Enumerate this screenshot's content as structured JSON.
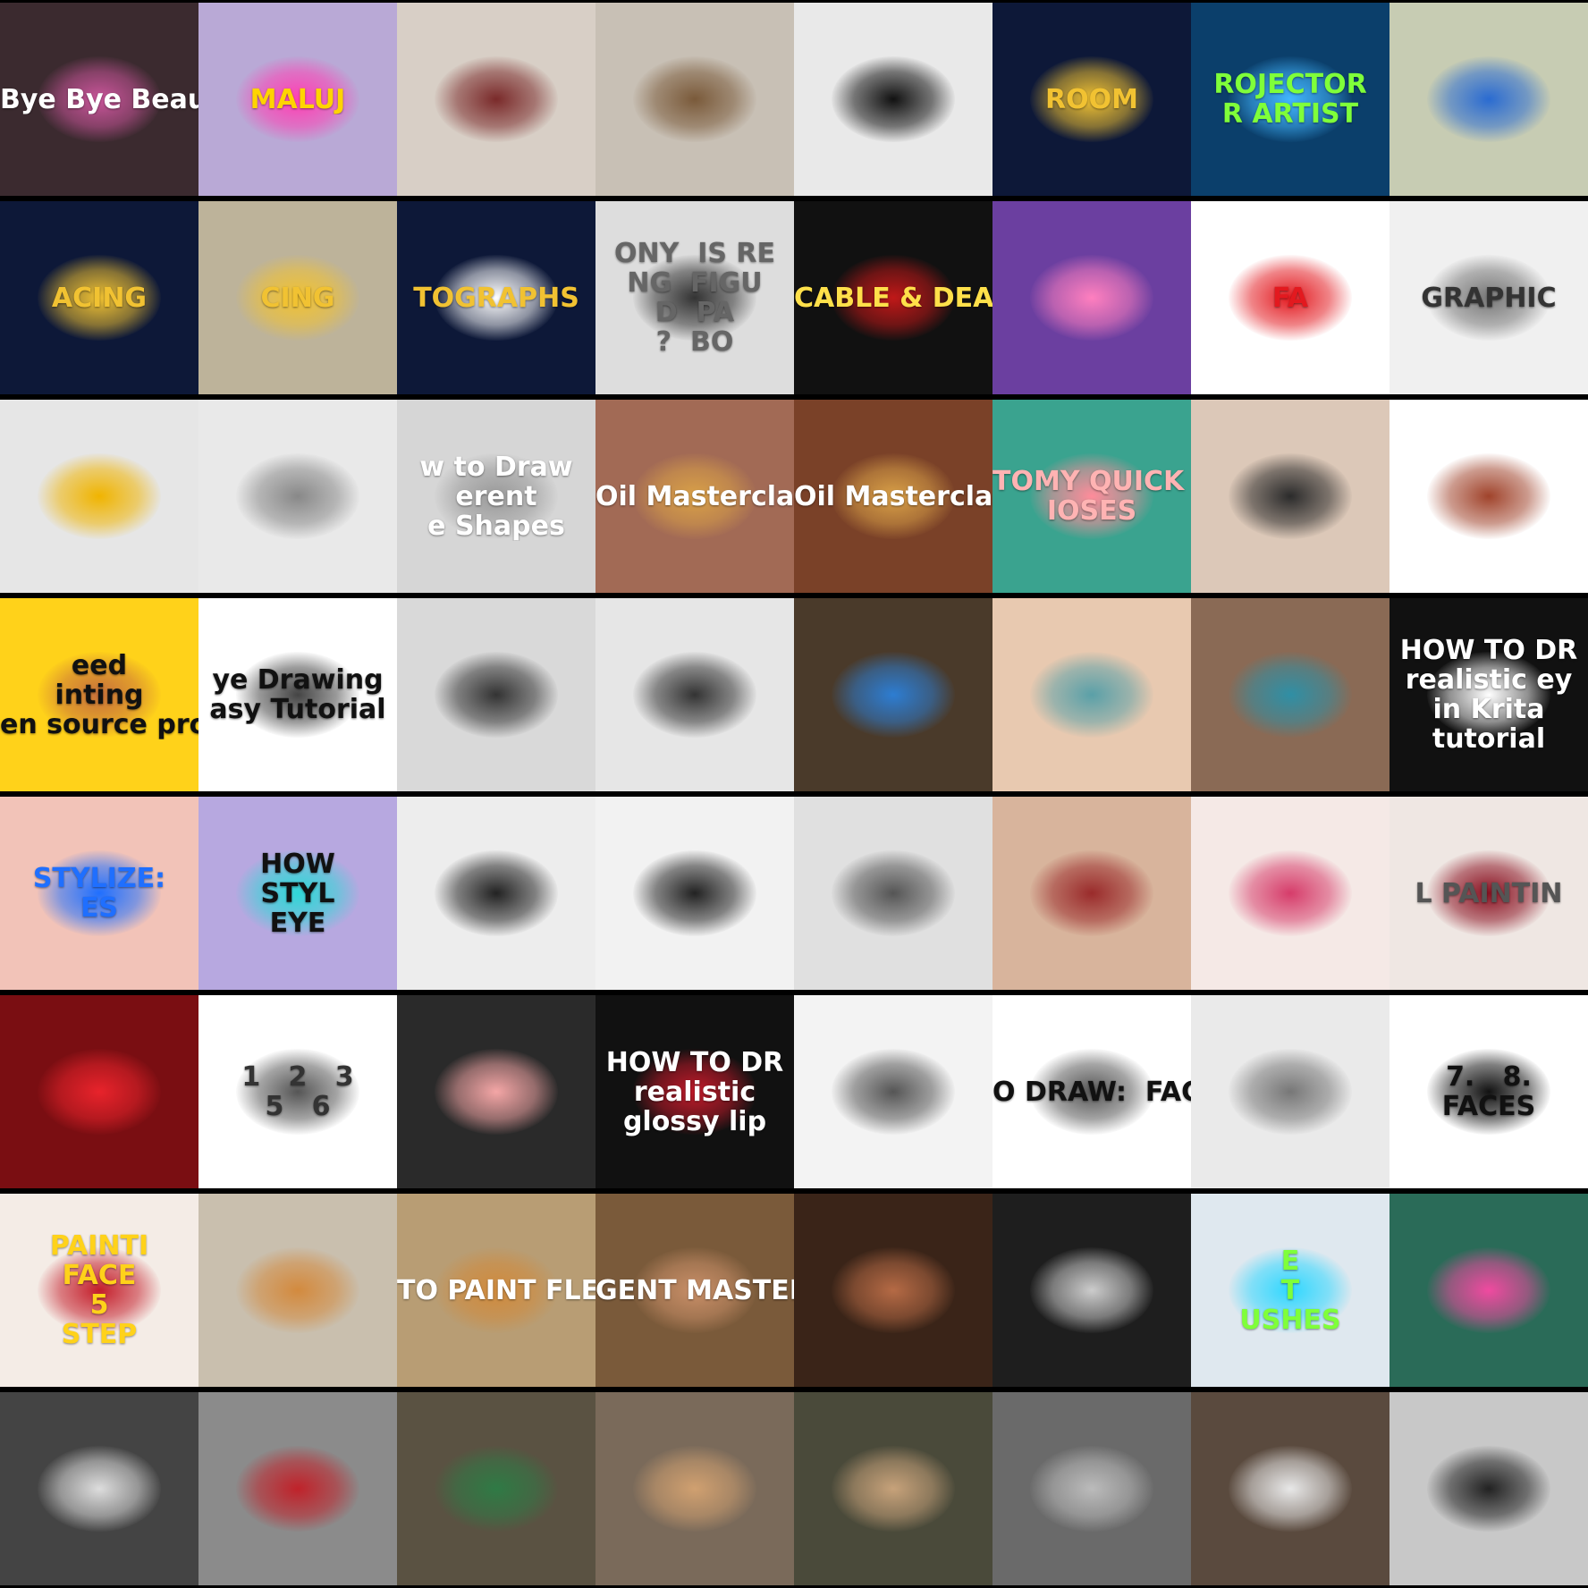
{
  "grid": {
    "title": "",
    "columns": 8,
    "rows": 8,
    "tiles": [
      {
        "caption": "Bye Bye Beauté",
        "bg": "#3b2a2f",
        "accent": "#c9559a",
        "text_color": "#ffffff",
        "icon": "portrait-icon"
      },
      {
        "caption": "MALUJ",
        "bg": "#b9a9d6",
        "accent": "#ff3fb4",
        "text_color": "#ffd400",
        "icon": "portrait-icon"
      },
      {
        "caption": "",
        "bg": "#d8cfc6",
        "accent": "#7a2a2a",
        "text_color": "#ffffff",
        "icon": "portrait-icon"
      },
      {
        "caption": "",
        "bg": "#c8c0b5",
        "accent": "#7a5a3a",
        "text_color": "#ffffff",
        "icon": "room-icon"
      },
      {
        "caption": "",
        "bg": "#e9e9e9",
        "accent": "#111111",
        "text_color": "#111111",
        "icon": "engraving-icon"
      },
      {
        "caption": "ROOM",
        "bg": "#0d1838",
        "accent": "#f1c232",
        "text_color": "#f1c232",
        "icon": "engraving-icon"
      },
      {
        "caption": "ROJECTOR\nR ARTIST",
        "bg": "#0b3f6b",
        "accent": "#41b6ff",
        "text_color": "#7fff3a",
        "icon": "projector-icon"
      },
      {
        "caption": "",
        "bg": "#c7ccb3",
        "accent": "#2a6bd1",
        "text_color": "#ffffff",
        "icon": "bird-icon"
      },
      {
        "caption": "ACING",
        "bg": "#0d1838",
        "accent": "#f1c232",
        "text_color": "#f1c232",
        "icon": "hand-icon"
      },
      {
        "caption": "CING",
        "bg": "#bdb39a",
        "accent": "#f1c232",
        "text_color": "#f1c232",
        "icon": "paper-icon"
      },
      {
        "caption": "TOGRAPHS",
        "bg": "#0d1838",
        "accent": "#ffffff",
        "text_color": "#f1c232",
        "icon": "easel-icon"
      },
      {
        "caption": "ONY  IS RE\nNG  FIGU\nD  PA\n?  BO",
        "bg": "#dddddd",
        "accent": "#333333",
        "text_color": "#666666",
        "icon": "person-icon"
      },
      {
        "caption": "CABLE & DEADPOOL",
        "bg": "#111111",
        "accent": "#c01818",
        "text_color": "#ffe04a",
        "icon": "comic-icon"
      },
      {
        "caption": "",
        "bg": "#6b3fa0",
        "accent": "#ff7fbf",
        "text_color": "#ffffff",
        "icon": "cartoon-icon"
      },
      {
        "caption": "FA",
        "bg": "#ffffff",
        "accent": "#e3191f",
        "text_color": "#e3191f",
        "icon": "portrait-icon"
      },
      {
        "caption": "GRAPHIC",
        "bg": "#f0f0f0",
        "accent": "#777777",
        "text_color": "#333333",
        "icon": "nose-icon"
      },
      {
        "caption": "",
        "bg": "#e6e6e6",
        "accent": "#f0b400",
        "text_color": "#333333",
        "icon": "nose-icon"
      },
      {
        "caption": "",
        "bg": "#e9e9e9",
        "accent": "#888888",
        "text_color": "#333333",
        "icon": "nose-icon"
      },
      {
        "caption": "w to Draw\nerent\ne Shapes",
        "bg": "#d6d6d6",
        "accent": "#999999",
        "text_color": "#ffffff",
        "icon": "nose-icon"
      },
      {
        "caption": "Oil Masterclass",
        "bg": "#a26a55",
        "accent": "#d9a047",
        "text_color": "#ffffff",
        "icon": "nose-icon"
      },
      {
        "caption": "Oil Masterclass",
        "bg": "#7a4128",
        "accent": "#d9a047",
        "text_color": "#ffffff",
        "icon": "nose-icon"
      },
      {
        "caption": "TOMY QUICK TIPS:\nIOSES",
        "bg": "#3aa38f",
        "accent": "#ff8c9a",
        "text_color": "#ffb3b3",
        "icon": "nose-icon"
      },
      {
        "caption": "",
        "bg": "#dcc8b8",
        "accent": "#2b2b2b",
        "text_color": "#333333",
        "icon": "nose-icon"
      },
      {
        "caption": "",
        "bg": "#ffffff",
        "accent": "#a0432b",
        "text_color": "#333333",
        "icon": "nose-icon"
      },
      {
        "caption": "eed\ninting\nen source program",
        "bg": "#ffd21a",
        "accent": "#c8703a",
        "text_color": "#111111",
        "icon": "nose-icon"
      },
      {
        "caption": "ye Drawing\nasy Tutorial",
        "bg": "#ffffff",
        "accent": "#444444",
        "text_color": "#111111",
        "icon": "eye-icon"
      },
      {
        "caption": "",
        "bg": "#d9d9d9",
        "accent": "#333333",
        "text_color": "#333333",
        "icon": "eye-icon"
      },
      {
        "caption": "",
        "bg": "#e6e6e6",
        "accent": "#333333",
        "text_color": "#333333",
        "icon": "eye-icon"
      },
      {
        "caption": "",
        "bg": "#4a3a2a",
        "accent": "#2d7dd2",
        "text_color": "#ffffff",
        "icon": "eye-icon"
      },
      {
        "caption": "",
        "bg": "#e8c9b0",
        "accent": "#5aa0a8",
        "text_color": "#333333",
        "icon": "eye-icon"
      },
      {
        "caption": "",
        "bg": "#8a6a55",
        "accent": "#2f8fa5",
        "text_color": "#ffffff",
        "icon": "eye-icon"
      },
      {
        "caption": "HOW TO DR\nrealistic ey\nin Krita\ntutorial",
        "bg": "#111111",
        "accent": "#ffffff",
        "text_color": "#ffffff",
        "icon": "eye-icon"
      },
      {
        "caption": "STYLIZE:\nES",
        "bg": "#f2c3b8",
        "accent": "#1f6fff",
        "text_color": "#1f6fff",
        "icon": "eye-icon"
      },
      {
        "caption": "HOW\nSTYL\nEYE",
        "bg": "#b7a8e0",
        "accent": "#2fd7d7",
        "text_color": "#111111",
        "icon": "eye-icon"
      },
      {
        "caption": "",
        "bg": "#ededed",
        "accent": "#222222",
        "text_color": "#333333",
        "icon": "lips-icon"
      },
      {
        "caption": "",
        "bg": "#f2f2f2",
        "accent": "#222222",
        "text_color": "#333333",
        "icon": "lips-icon"
      },
      {
        "caption": "",
        "bg": "#e0e0e0",
        "accent": "#555555",
        "text_color": "#333333",
        "icon": "lips-icon"
      },
      {
        "caption": "",
        "bg": "#d8b49c",
        "accent": "#9a2b2b",
        "text_color": "#333333",
        "icon": "lips-icon"
      },
      {
        "caption": "",
        "bg": "#f5e9e6",
        "accent": "#d63c6a",
        "text_color": "#333333",
        "icon": "lips-icon"
      },
      {
        "caption": "L PAINTIN",
        "bg": "#efe7e3",
        "accent": "#8a1020",
        "text_color": "#555555",
        "icon": "lips-icon"
      },
      {
        "caption": "",
        "bg": "#7a0e12",
        "accent": "#e8232b",
        "text_color": "#ffffff",
        "icon": "lips-icon"
      },
      {
        "caption": "1   2   3\n5   6",
        "bg": "#ffffff",
        "accent": "#555555",
        "text_color": "#333333",
        "icon": "lips-icon"
      },
      {
        "caption": "",
        "bg": "#2a2a2a",
        "accent": "#f4a6a6",
        "text_color": "#ffffff",
        "icon": "lips-icon"
      },
      {
        "caption": "HOW TO DR\nrealistic\nglossy lip",
        "bg": "#111111",
        "accent": "#c11a2a",
        "text_color": "#ffffff",
        "icon": "lips-icon"
      },
      {
        "caption": "",
        "bg": "#f3f3f3",
        "accent": "#555555",
        "text_color": "#333333",
        "icon": "face-icon"
      },
      {
        "caption": "O DRAW:  FACE IN",
        "bg": "#ffffff",
        "accent": "#555555",
        "text_color": "#111111",
        "icon": "face-icon"
      },
      {
        "caption": "",
        "bg": "#eaeaea",
        "accent": "#777777",
        "text_color": "#333333",
        "icon": "face-icon"
      },
      {
        "caption": "7.   8.\nFACES",
        "bg": "#ffffff",
        "accent": "#111111",
        "text_color": "#111111",
        "icon": "face-icon"
      },
      {
        "caption": "PAINTI\nFACE\n5\nSTEP",
        "bg": "#f4ece6",
        "accent": "#c41d2a",
        "text_color": "#ffd21a",
        "icon": "face-icon"
      },
      {
        "caption": "",
        "bg": "#c9bfae",
        "accent": "#d38a3e",
        "text_color": "#333333",
        "icon": "face-icon"
      },
      {
        "caption": "TO PAINT FLESH CO",
        "bg": "#b89d74",
        "accent": "#d08a3c",
        "text_color": "#ffffff",
        "icon": "face-icon"
      },
      {
        "caption": "GENT MASTER C",
        "bg": "#7a5a3a",
        "accent": "#c98f68",
        "text_color": "#ffffff",
        "icon": "face-icon"
      },
      {
        "caption": "",
        "bg": "#3a2418",
        "accent": "#b56a45",
        "text_color": "#ffffff",
        "icon": "face-icon"
      },
      {
        "caption": "",
        "bg": "#1e1e1e",
        "accent": "#cccccc",
        "text_color": "#ffffff",
        "icon": "face-icon"
      },
      {
        "caption": "E\nT\nUSHES",
        "bg": "#dfe8ef",
        "accent": "#2fd7ff",
        "text_color": "#7fff3a",
        "icon": "face-icon"
      },
      {
        "caption": "",
        "bg": "#2a6b58",
        "accent": "#f04aa0",
        "text_color": "#ffffff",
        "icon": "face-icon"
      },
      {
        "caption": "",
        "bg": "#444444",
        "accent": "#dddddd",
        "text_color": "#ffffff",
        "icon": "eye-icon"
      },
      {
        "caption": "",
        "bg": "#8b8b8b",
        "accent": "#c0222a",
        "text_color": "#ffffff",
        "icon": "street-icon"
      },
      {
        "caption": "",
        "bg": "#5a5242",
        "accent": "#2f7a45",
        "text_color": "#ffffff",
        "icon": "street-icon"
      },
      {
        "caption": "",
        "bg": "#7a6a5a",
        "accent": "#d0a070",
        "text_color": "#ffffff",
        "icon": "street-icon"
      },
      {
        "caption": "",
        "bg": "#4a4a3a",
        "accent": "#c7a27a",
        "text_color": "#ffffff",
        "icon": "street-icon"
      },
      {
        "caption": "",
        "bg": "#6a6a6a",
        "accent": "#bbbbbb",
        "text_color": "#ffffff",
        "icon": "portrait-icon"
      },
      {
        "caption": "",
        "bg": "#5a4a3e",
        "accent": "#e8e8e8",
        "text_color": "#ffffff",
        "icon": "person-icon"
      },
      {
        "caption": "",
        "bg": "#c8c8c8",
        "accent": "#222222",
        "text_color": "#333333",
        "icon": "portrait-icon"
      }
    ]
  }
}
